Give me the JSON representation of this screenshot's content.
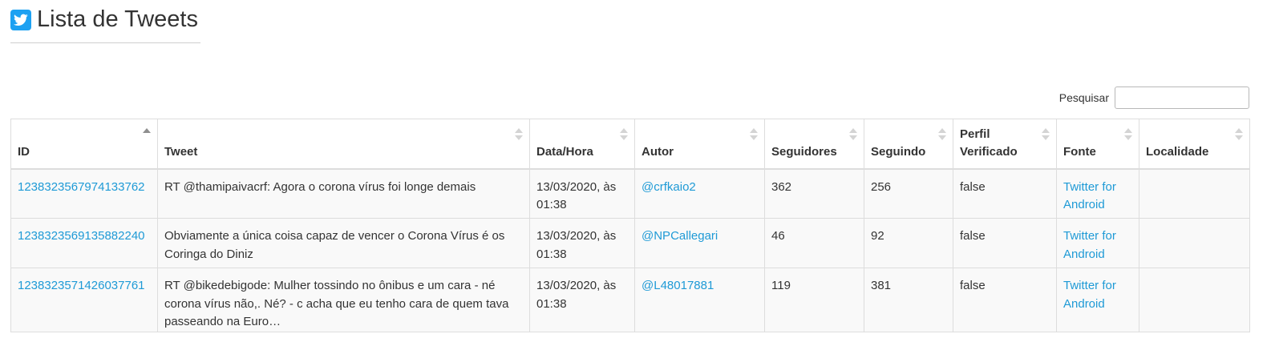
{
  "header": {
    "title": "Lista de Tweets",
    "icon": "twitter-icon",
    "icon_color": "#1da1f2"
  },
  "search": {
    "label": "Pesquisar",
    "value": "",
    "placeholder": ""
  },
  "table": {
    "columns": [
      {
        "label": "ID",
        "sort": "asc"
      },
      {
        "label": "Tweet",
        "sort": "none"
      },
      {
        "label": "Data/Hora",
        "sort": "none"
      },
      {
        "label": "Autor",
        "sort": "none"
      },
      {
        "label": "Seguidores",
        "sort": "none"
      },
      {
        "label": "Seguindo",
        "sort": "none"
      },
      {
        "label": "Perfil Verificado",
        "sort": "none"
      },
      {
        "label": "Fonte",
        "sort": "none"
      },
      {
        "label": "Localidade",
        "sort": "none"
      }
    ],
    "rows": [
      {
        "id": "1238323567974133762",
        "tweet": "RT @thamipaivacrf: Agora o corona vírus foi longe demais",
        "datetime": "13/03/2020, às 01:38",
        "author": "@crfkaio2",
        "followers": "362",
        "following": "256",
        "verified": "false",
        "source": "Twitter for Android",
        "location": ""
      },
      {
        "id": "1238323569135882240",
        "tweet": "Obviamente a única coisa capaz de vencer o Corona Vírus é os Coringa do Diniz",
        "datetime": "13/03/2020, às 01:38",
        "author": "@NPCallegari",
        "followers": "46",
        "following": "92",
        "verified": "false",
        "source": "Twitter for Android",
        "location": ""
      },
      {
        "id": "1238323571426037761",
        "tweet": "RT @bikedebigode: Mulher tossindo no ônibus e um cara - né corona vírus não,. Né? - c acha que eu tenho cara de quem tava passeando na Euro…",
        "datetime": "13/03/2020, às 01:38",
        "author": "@L48017881",
        "followers": "119",
        "following": "381",
        "verified": "false",
        "source": "Twitter for Android",
        "location": ""
      }
    ]
  },
  "colors": {
    "link": "#1e9ad6",
    "row_background": "#f9f9f9",
    "border": "#dddddd"
  }
}
